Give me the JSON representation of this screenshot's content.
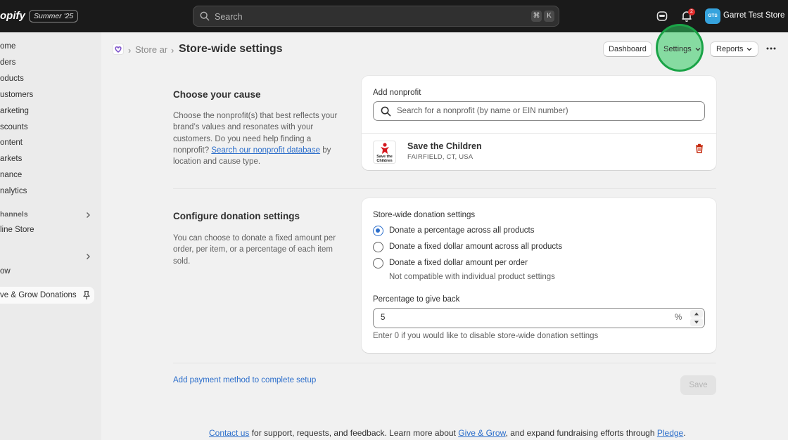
{
  "topbar": {
    "brand": "opify",
    "edition_badge": "Summer '25",
    "search_placeholder": "Search",
    "shortcut_keys": [
      "⌘",
      "K"
    ],
    "notification_count": "2",
    "avatar_initials": "GTS",
    "store_name": "Garret Test Store"
  },
  "sidebar": {
    "items": [
      "ome",
      "ders",
      "oducts",
      "ustomers",
      "arketing",
      "scounts",
      "ontent",
      "arkets",
      "nance",
      "nalytics"
    ],
    "channels_heading": "hannels",
    "online_store": "line Store",
    "apps_item": "ow",
    "pinned_app": "ve & Grow Donations"
  },
  "header": {
    "breadcrumb_previous": "Store and",
    "page_title": "Store-wide settings",
    "buttons": {
      "dashboard": "Dashboard",
      "settings": "Settings",
      "reports": "Reports"
    }
  },
  "cause_section": {
    "title": "Choose your cause",
    "description_before": "Choose the nonprofit(s) that best reflects your brand’s values and resonates with your customers. Do you need help finding a nonprofit? ",
    "description_link": "Search our nonprofit database",
    "description_after": " by location and cause type.",
    "card": {
      "label": "Add nonprofit",
      "search_placeholder": "Search for a nonprofit (by name or EIN number)",
      "nonprofit": {
        "logo_text": "Save the Children",
        "name": "Save the Children",
        "location": "FAIRFIELD, CT, USA"
      }
    }
  },
  "donation_section": {
    "title": "Configure donation settings",
    "description": "You can choose to donate a fixed amount per order, per item, or a percentage of each item sold.",
    "card": {
      "label": "Store-wide donation settings",
      "options": [
        {
          "label": "Donate a percentage across all products",
          "checked": true
        },
        {
          "label": "Donate a fixed dollar amount across all products",
          "checked": false
        },
        {
          "label": "Donate a fixed dollar amount per order",
          "checked": false
        }
      ],
      "option_help": "Not compatible with individual product settings",
      "percentage_label": "Percentage to give back",
      "percentage_value": "5",
      "percentage_suffix": "%",
      "percentage_help": "Enter 0 if you would like to disable store-wide donation settings"
    }
  },
  "footer": {
    "payment_link": "Add payment method to complete setup",
    "save_label": "Save",
    "support": {
      "contact_link": "Contact us",
      "text_1": " for support, requests, and feedback. Learn more about ",
      "give_grow_link": "Give & Grow",
      "text_2": ", and expand fundraising efforts through ",
      "pledge_link": "Pledge",
      "text_3": "."
    }
  },
  "colors": {
    "accent": "#2c6ecb",
    "highlight": "#2dc95f",
    "danger": "#e22c2c"
  }
}
